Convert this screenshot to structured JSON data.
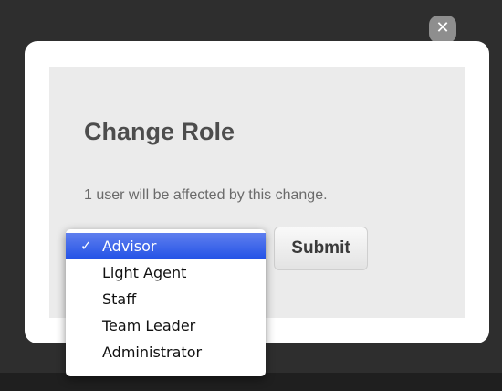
{
  "close_icon_glyph": "✕",
  "dialog": {
    "title": "Change Role",
    "description": "1 user will be affected by this change.",
    "submit_label": "Submit"
  },
  "role_select": {
    "check_glyph": "✓",
    "selected": "Advisor",
    "options": [
      {
        "label": "Advisor"
      },
      {
        "label": "Light Agent"
      },
      {
        "label": "Staff"
      },
      {
        "label": "Team Leader"
      },
      {
        "label": "Administrator"
      }
    ]
  },
  "colors": {
    "overlay": "#2e2e2e",
    "panel": "#ebebeb",
    "selection": "#2352e6"
  }
}
